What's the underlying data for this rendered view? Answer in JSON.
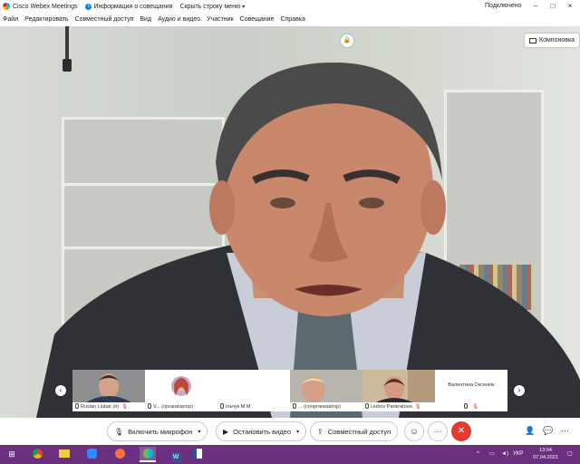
{
  "titlebar": {
    "app_title": "Cisco Webex Meetings",
    "meeting_info": "Информация о совещании",
    "hide_menu": "Скрыть строку меню",
    "status": "Подключено",
    "minimize": "–",
    "maximize": "□",
    "close": "×"
  },
  "menu": [
    "Файл",
    "Редактировать",
    "Совместный доступ",
    "Вид",
    "Аудио и видео",
    "Участник",
    "Совещание",
    "Справка"
  ],
  "video": {
    "layout_label": "Компоновка"
  },
  "filmstrip": [
    {
      "caption": "Ruslan Liubar (я)",
      "muted": true
    },
    {
      "caption": "V... (организатор)",
      "muted": false
    },
    {
      "caption": "Ільчук М М",
      "muted": false
    },
    {
      "caption": "... (соорганизатор)",
      "muted": false
    },
    {
      "caption": "Liubov Pankratova",
      "muted": true
    },
    {
      "caption": "Валентина Оксенюк",
      "muted": true
    }
  ],
  "controls": {
    "mic_label": "Включить микрофон",
    "video_label": "Остановить видео",
    "share_label": "Совместный доступ",
    "more": "···",
    "end": "✕"
  },
  "taskbar": {
    "lang": "УКР",
    "time": "13:04",
    "date": "07.04.2021"
  },
  "colors": {
    "taskbar": "#6a2f7e",
    "end_button": "#e43a2f",
    "muted": "#dd3333"
  }
}
